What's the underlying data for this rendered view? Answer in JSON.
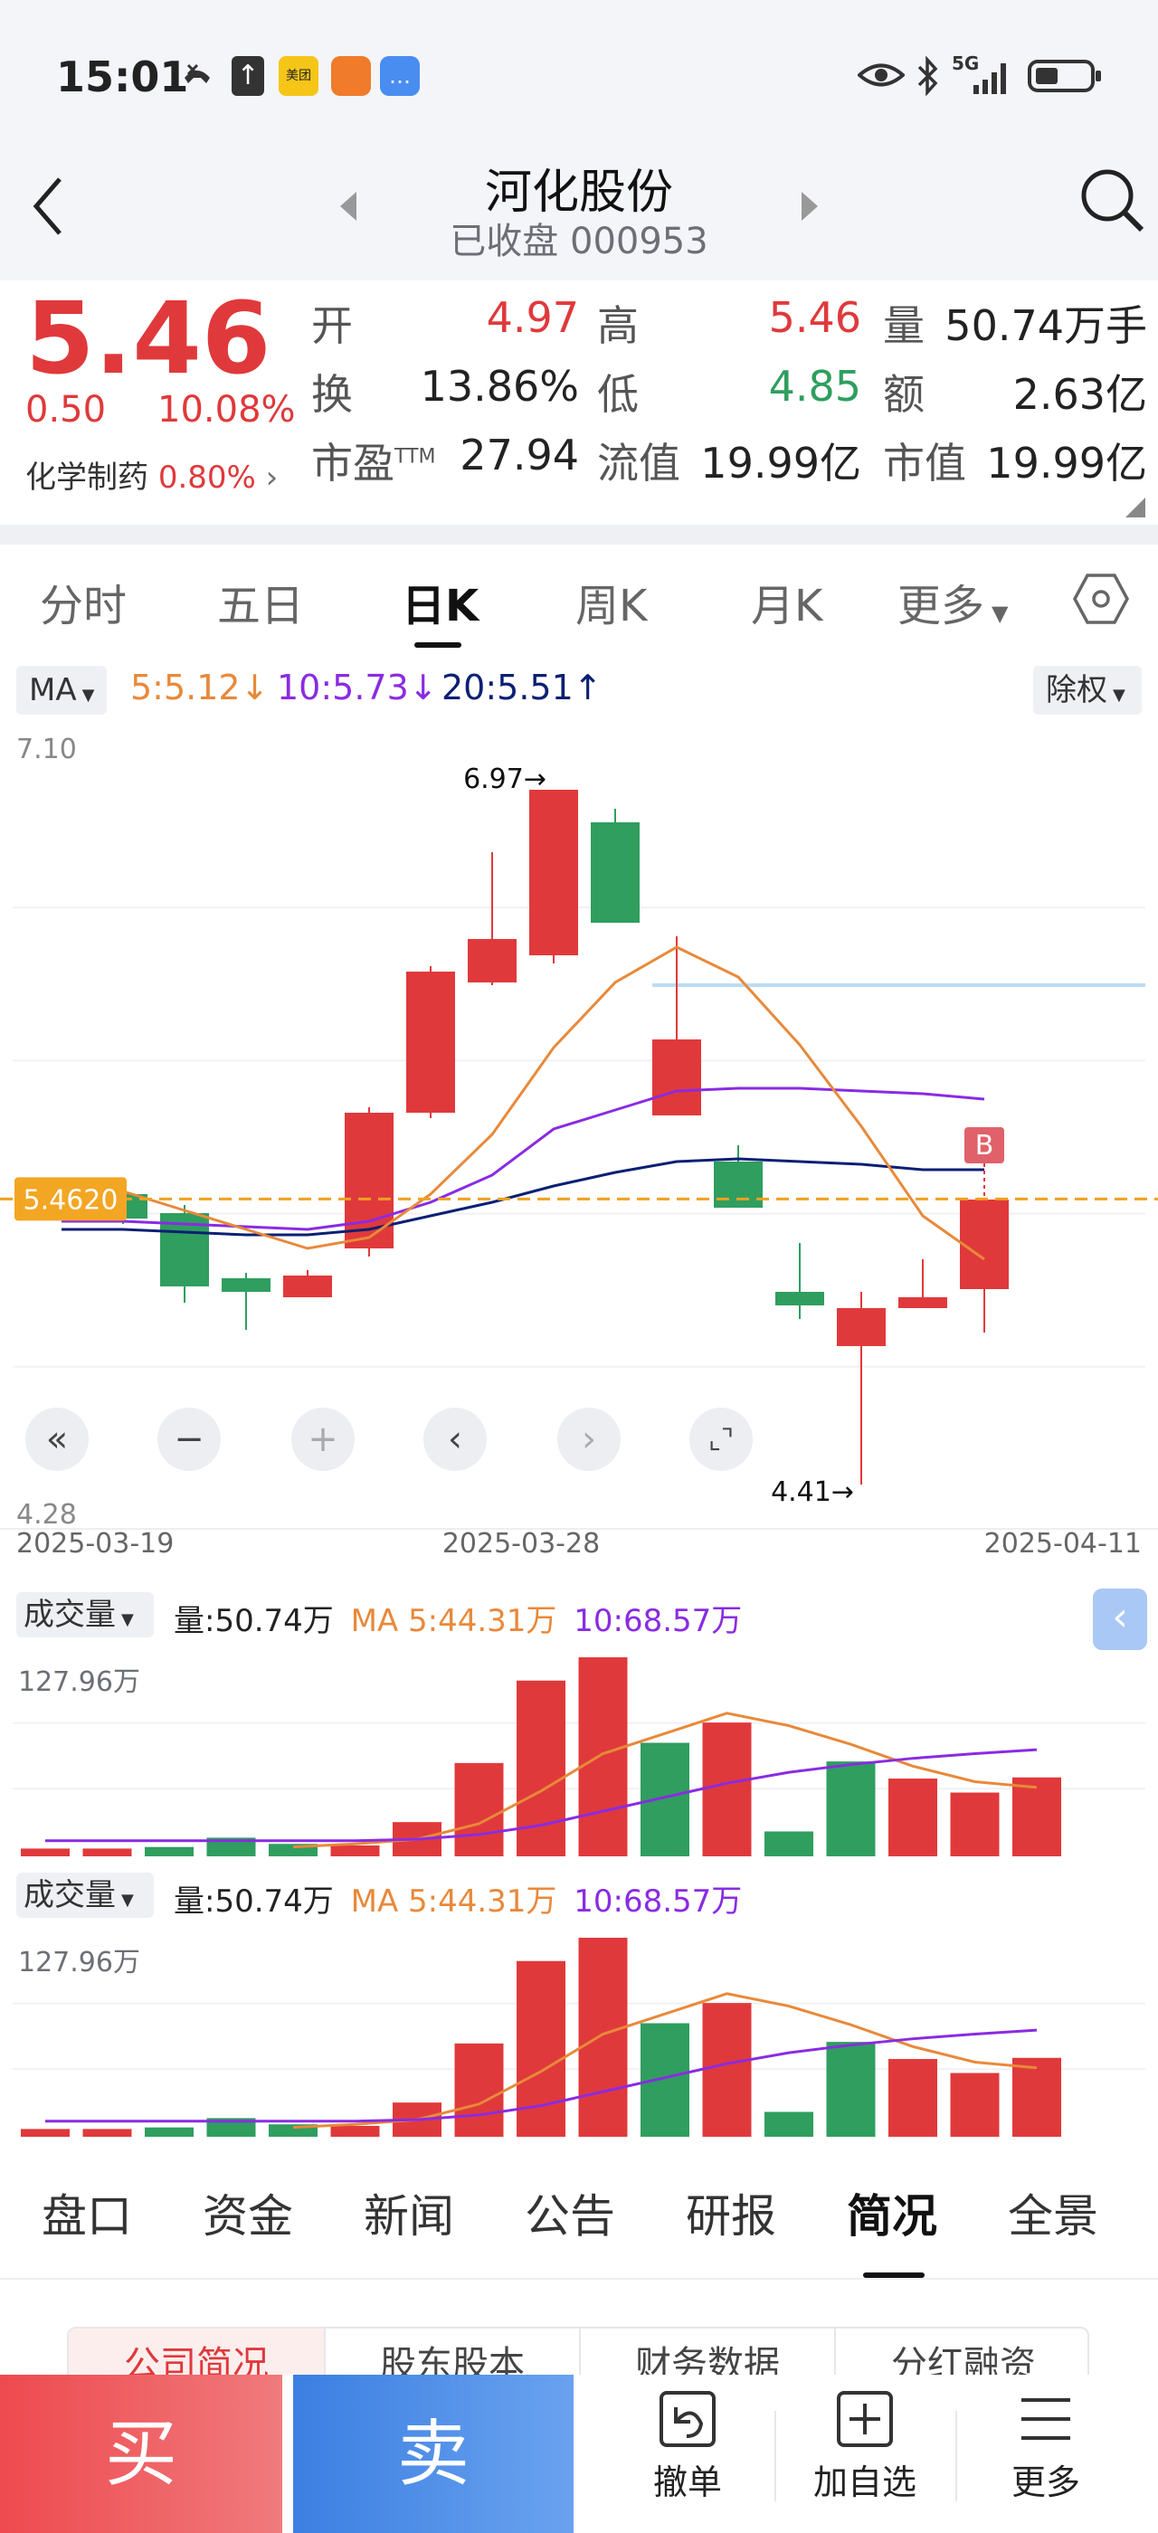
{
  "status_bar": {
    "time": "15:01",
    "app_badges": [
      "missed-call-icon",
      "upload-icon",
      "meituan-app-icon",
      "orange-app-icon",
      "message-app-icon"
    ],
    "network": "5G",
    "right_icons": [
      "eye-icon",
      "bluetooth-icon",
      "signal-icon",
      "battery-icon"
    ]
  },
  "header": {
    "stock_name": "河化股份",
    "status": "已收盘",
    "code": "000953"
  },
  "quote": {
    "price": "5.46",
    "change": "0.50",
    "change_pct": "10.08%",
    "sector": "化学制药",
    "sector_pct": "0.80%",
    "open_label": "开",
    "open": "4.97",
    "high_label": "高",
    "high": "5.46",
    "volume_label": "量",
    "volume": "50.74万手",
    "turnover_label": "换",
    "turnover": "13.86%",
    "low_label": "低",
    "low": "4.85",
    "amount_label": "额",
    "amount": "2.63亿",
    "pe_label": "市盈",
    "pe_suffix": "TTM",
    "pe": "27.94",
    "float_cap_label": "流值",
    "float_cap": "19.99亿",
    "mkt_cap_label": "市值",
    "mkt_cap": "19.99亿"
  },
  "period_tabs": [
    "分时",
    "五日",
    "日K",
    "周K",
    "月K",
    "更多"
  ],
  "active_period": "日K",
  "ma_bar": {
    "ma_select": "MA",
    "ma5": "5:5.12",
    "ma10": "10:5.73",
    "ma20": "20:5.51",
    "adjust_select": "除权"
  },
  "colors": {
    "up": "#e0393b",
    "down": "#2f9e5f",
    "ma5": "#e8893a",
    "ma10": "#8a2be2",
    "ma20": "#0b1f74",
    "price_line": "#f0a020"
  },
  "chart_data": {
    "type": "candlestick",
    "y_top_label": "7.10",
    "y_bottom_label": "4.28",
    "ylim": [
      4.28,
      7.1
    ],
    "current_price_label": "5.4620",
    "current_price": 5.462,
    "max_annotation": "6.97→",
    "min_annotation": "4.41→",
    "date_labels": [
      "2025-03-19",
      "2025-03-28",
      "2025-04-11"
    ],
    "marker": "B",
    "candles": [
      {
        "o": 5.52,
        "c": 5.5,
        "h": 5.54,
        "l": 5.48
      },
      {
        "o": 5.48,
        "c": 5.39,
        "h": 5.5,
        "l": 5.37
      },
      {
        "o": 5.41,
        "c": 5.14,
        "h": 5.44,
        "l": 5.08
      },
      {
        "o": 5.17,
        "c": 5.12,
        "h": 5.19,
        "l": 4.98
      },
      {
        "o": 5.1,
        "c": 5.18,
        "h": 5.2,
        "l": 5.1
      },
      {
        "o": 5.28,
        "c": 5.78,
        "h": 5.8,
        "l": 5.25
      },
      {
        "o": 5.78,
        "c": 6.3,
        "h": 6.32,
        "l": 5.76
      },
      {
        "o": 6.26,
        "c": 6.42,
        "h": 6.74,
        "l": 6.25
      },
      {
        "o": 6.36,
        "c": 6.97,
        "h": 6.97,
        "l": 6.33
      },
      {
        "o": 6.85,
        "c": 6.48,
        "h": 6.9,
        "l": 6.48
      },
      {
        "o": 5.77,
        "c": 6.05,
        "h": 6.43,
        "l": 5.77
      },
      {
        "o": 5.6,
        "c": 5.43,
        "h": 5.66,
        "l": 5.43
      },
      {
        "o": 5.12,
        "c": 5.07,
        "h": 5.3,
        "l": 5.02
      },
      {
        "o": 4.92,
        "c": 5.06,
        "h": 5.12,
        "l": 4.41
      },
      {
        "o": 5.06,
        "c": 5.1,
        "h": 5.24,
        "l": 5.06
      },
      {
        "o": 5.13,
        "c": 5.46,
        "h": 5.46,
        "l": 4.97
      }
    ],
    "ma5": [
      5.53,
      5.49,
      5.42,
      5.35,
      5.28,
      5.32,
      5.48,
      5.7,
      6.02,
      6.26,
      6.39,
      6.28,
      6.03,
      5.73,
      5.4,
      5.24
    ],
    "ma10": [
      5.38,
      5.38,
      5.37,
      5.36,
      5.35,
      5.38,
      5.45,
      5.55,
      5.72,
      5.79,
      5.86,
      5.87,
      5.87,
      5.86,
      5.85,
      5.83
    ],
    "ma20": [
      5.35,
      5.35,
      5.34,
      5.33,
      5.33,
      5.35,
      5.4,
      5.45,
      5.51,
      5.56,
      5.6,
      5.61,
      5.6,
      5.59,
      5.57,
      5.57
    ],
    "resistance_level": 6.25
  },
  "chart_controls": [
    "double-left-icon",
    "minus-icon",
    "plus-icon",
    "chevron-left-icon",
    "chevron-right-icon",
    "expand-icon"
  ],
  "volume_panels": [
    {
      "select": "成交量",
      "volume": "量:50.74万",
      "ma5": "MA 5:44.31万",
      "ma10": "10:68.57万",
      "ymax_label": "127.96万"
    },
    {
      "select": "成交量",
      "volume": "量:50.74万",
      "ma5": "MA 5:44.31万",
      "ma10": "10:68.57万",
      "ymax_label": "127.96万"
    }
  ],
  "volume_data": {
    "ymax": 127.96,
    "bars": [
      {
        "v": 5,
        "up": true
      },
      {
        "v": 5,
        "up": true
      },
      {
        "v": 6,
        "up": false
      },
      {
        "v": 12,
        "up": false
      },
      {
        "v": 8,
        "up": false
      },
      {
        "v": 7,
        "up": true
      },
      {
        "v": 22,
        "up": true
      },
      {
        "v": 60,
        "up": true
      },
      {
        "v": 113,
        "up": true
      },
      {
        "v": 127.96,
        "up": true
      },
      {
        "v": 73,
        "up": false
      },
      {
        "v": 86,
        "up": true
      },
      {
        "v": 16,
        "up": false
      },
      {
        "v": 61,
        "up": false
      },
      {
        "v": 50,
        "up": true
      },
      {
        "v": 41,
        "up": true
      },
      {
        "v": 50.74,
        "up": true
      }
    ],
    "ma5": [
      null,
      null,
      null,
      null,
      6,
      8,
      11,
      21,
      42,
      66,
      79,
      92,
      84,
      72,
      58,
      48,
      44.31
    ],
    "ma10": [
      10,
      10,
      10,
      10,
      10,
      10,
      11,
      14,
      20,
      29,
      38,
      47,
      54,
      59,
      63,
      66,
      68.57
    ]
  },
  "bottom_tabs": [
    "盘口",
    "资金",
    "新闻",
    "公告",
    "研报",
    "简况",
    "全景"
  ],
  "active_bottom_tab": "简况",
  "sub_tabs": [
    "公司简况",
    "股东股本",
    "财务数据",
    "分红融资"
  ],
  "action_bar": {
    "buy": "买",
    "sell": "卖",
    "cancel_order": "撤单",
    "add_watch": "加自选",
    "more": "更多"
  }
}
